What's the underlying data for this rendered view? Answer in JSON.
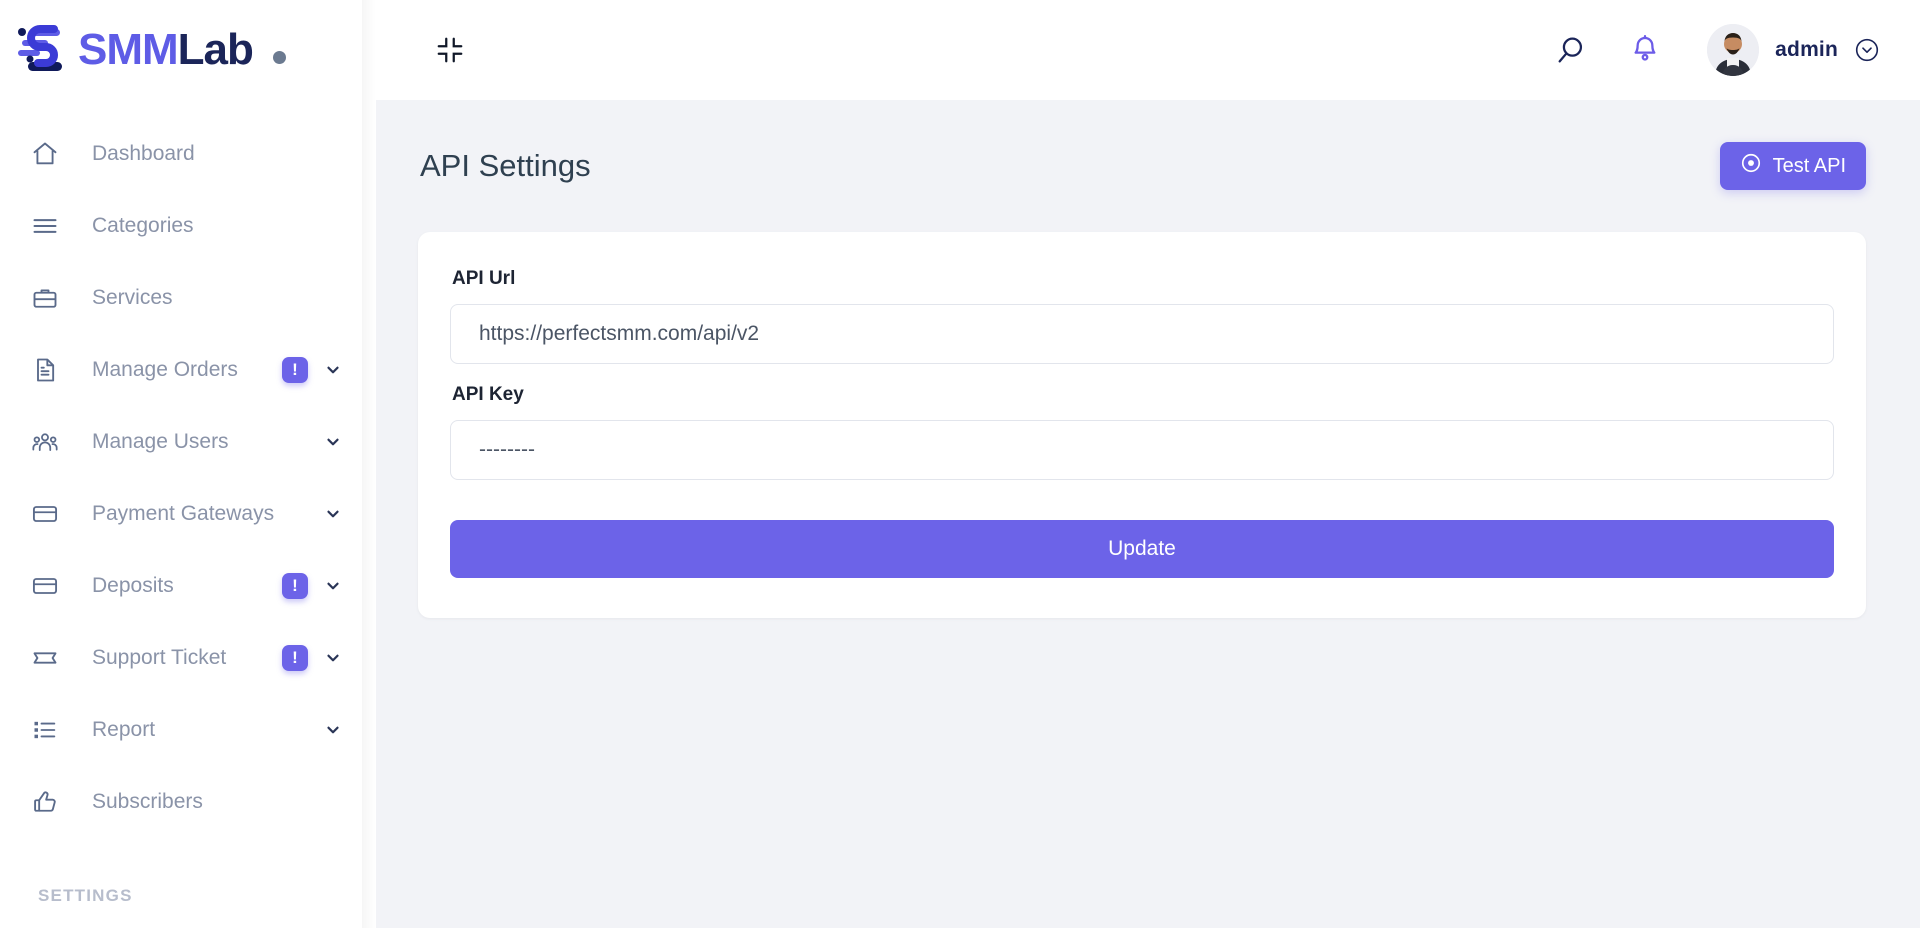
{
  "brand": {
    "text_primary": "SMM",
    "text_secondary": "Lab",
    "accent_color": "#5e5ce6",
    "dark_color": "#1b2559"
  },
  "sidebar": {
    "items": [
      {
        "label": "Dashboard",
        "icon": "home-icon",
        "badge": "",
        "chevron": false
      },
      {
        "label": "Categories",
        "icon": "list-lines-icon",
        "badge": "",
        "chevron": false
      },
      {
        "label": "Services",
        "icon": "briefcase-icon",
        "badge": "",
        "chevron": false
      },
      {
        "label": "Manage Orders",
        "icon": "document-icon",
        "badge": "!",
        "chevron": true
      },
      {
        "label": "Manage Users",
        "icon": "users-icon",
        "badge": "",
        "chevron": true
      },
      {
        "label": "Payment Gateways",
        "icon": "credit-card-icon",
        "badge": "",
        "chevron": true
      },
      {
        "label": "Deposits",
        "icon": "credit-card-icon",
        "badge": "!",
        "chevron": true
      },
      {
        "label": "Support Ticket",
        "icon": "ticket-icon",
        "badge": "!",
        "chevron": true
      },
      {
        "label": "Report",
        "icon": "report-list-icon",
        "badge": "",
        "chevron": true
      },
      {
        "label": "Subscribers",
        "icon": "thumbs-up-icon",
        "badge": "",
        "chevron": false
      }
    ],
    "section_label": "SETTINGS",
    "badge_color": "#6c63e8"
  },
  "topbar": {
    "collapse_icon": "compress-icon",
    "search_icon": "search-icon",
    "notification_icon": "bell-icon",
    "user_name": "admin",
    "user_chevron_icon": "chevron-down-circle-icon"
  },
  "page": {
    "title": "API Settings",
    "test_button_label": "Test API",
    "test_button_icon": "record-circle-icon",
    "accent_color": "#6c63e8"
  },
  "form": {
    "api_url": {
      "label": "API Url",
      "value": "https://perfectsmm.com/api/v2",
      "placeholder": "API Url"
    },
    "api_key": {
      "label": "API Key",
      "value": "--------",
      "placeholder": "API Key"
    },
    "submit_label": "Update"
  }
}
